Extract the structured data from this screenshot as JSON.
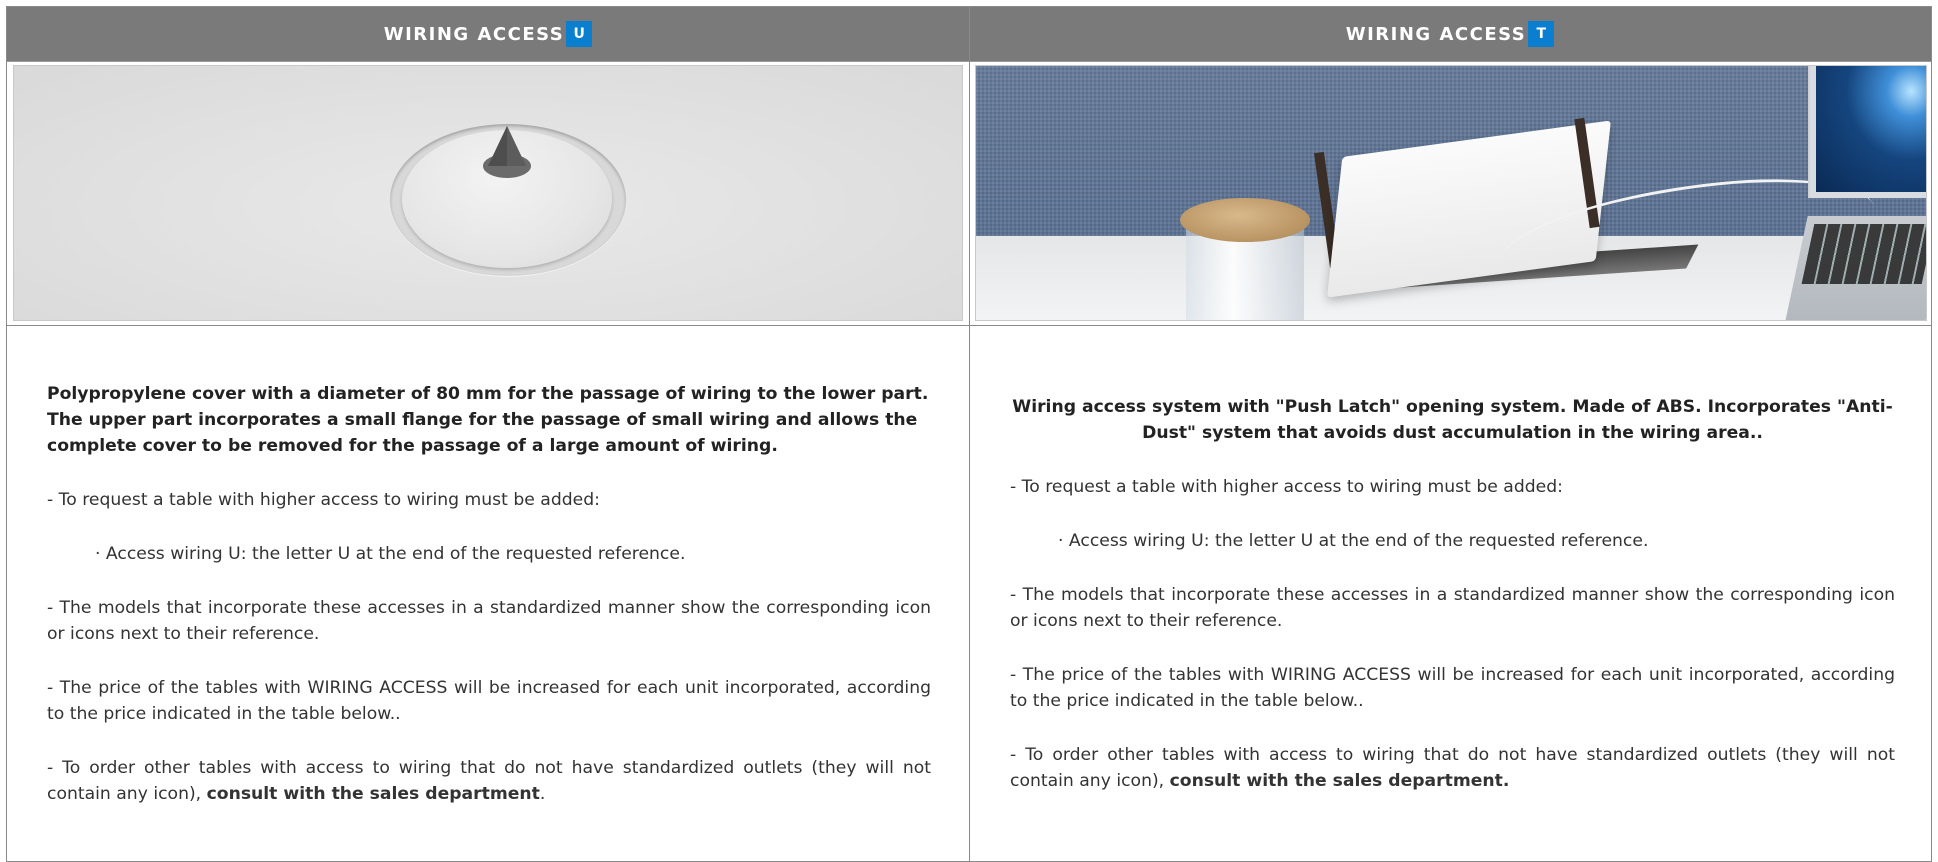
{
  "columns": [
    {
      "header": "WIRING ACCESS",
      "badge": "U",
      "lead": "Polypropylene cover with a diameter of 80 mm for the passage of wiring to the lower part. The upper part incorporates a small flange for the passage of small wiring and allows the complete cover to be removed for the passage of a large amount of wiring.",
      "request_intro": "- To request a table with higher access to wiring must be added:",
      "request_item": "· Access wiring U: the letter U at the end of the requested reference.",
      "models_note": "- The models that incorporate these accesses in a standardized manner show the corresponding icon or icons next to their reference.",
      "price_note": "- The price of the tables with WIRING ACCESS will be increased for each unit incorporated, according to the price indicated in the table below..",
      "order_note": "- To order other tables with access to wiring that do not have standardized outlets (they will not contain any icon), ",
      "order_note_bold": "consult with the sales department",
      "order_note_end": "."
    },
    {
      "header": "WIRING ACCESS",
      "badge": "T",
      "lead": "Wiring access system with \"Push Latch\" opening system. Made of ABS. Incorporates \"Anti-Dust\" system that avoids dust accumulation in the wiring area..",
      "request_intro": "- To request a table with higher access to wiring must be added:",
      "request_item": "· Access wiring U: the letter U at the end of the requested reference.",
      "models_note": "- The models that incorporate these accesses in a standardized manner show the corresponding icon or icons next to their reference.",
      "price_note": "- The price of the tables with WIRING ACCESS will be increased for each unit incorporated, according to the price indicated in the table below..",
      "order_note": "- To order other tables with access to wiring that do not have standardized outlets (they will not contain any icon), ",
      "order_note_bold": "consult with the sales department.",
      "order_note_end": ""
    }
  ],
  "colors": {
    "header_bg": "#7a7a7a",
    "badge_bg": "#0a7fd0",
    "header_text": "#ffffff",
    "body_text": "#333333"
  }
}
